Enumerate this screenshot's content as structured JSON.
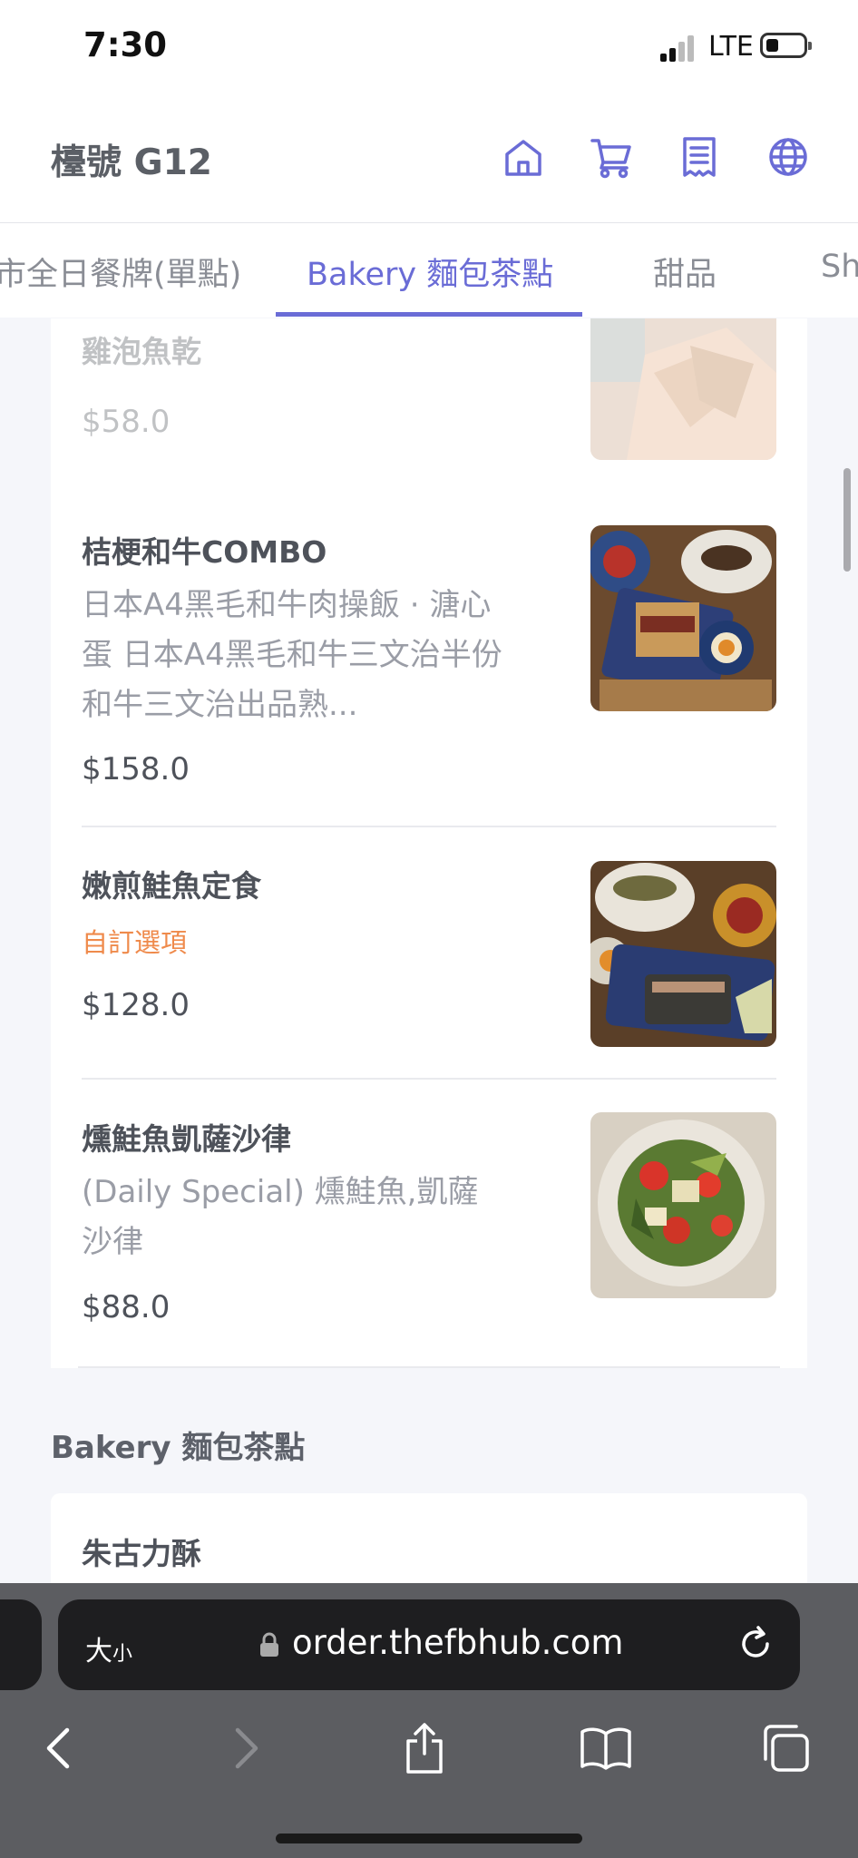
{
  "status_bar": {
    "time": "7:30",
    "network": "LTE"
  },
  "header": {
    "table_label": "檯號 G12",
    "icons": [
      "home-icon",
      "cart-icon",
      "receipt-icon",
      "globe-icon"
    ]
  },
  "tabs": [
    {
      "label": "市全日餐牌(單點)"
    },
    {
      "label": "Bakery 麵包茶點"
    },
    {
      "label": "甜品"
    },
    {
      "label": "Sh"
    }
  ],
  "items": [
    {
      "name": "雞泡魚乾",
      "price": "$58.0"
    },
    {
      "name": "桔梗和牛COMBO",
      "desc": "日本A4黑毛和牛肉操飯 · 溏心蛋 日本A4黑毛和牛三文治半份 和牛三文治出品熟...",
      "price": "$158.0"
    },
    {
      "name": "嫩煎鮭魚定食",
      "option": "自訂選項",
      "price": "$128.0"
    },
    {
      "name": "燻鮭魚凱薩沙律",
      "desc": "(Daily Special) 燻鮭魚,凱薩沙律",
      "price": "$88.0"
    }
  ],
  "section": {
    "title": "Bakery 麵包茶點",
    "first_item": "朱古力酥"
  },
  "browser": {
    "text_size_big": "大",
    "text_size_small": "小",
    "url": "order.thefbhub.com"
  },
  "colors": {
    "accent": "#6a6cd6",
    "option": "#ef8a4b"
  }
}
